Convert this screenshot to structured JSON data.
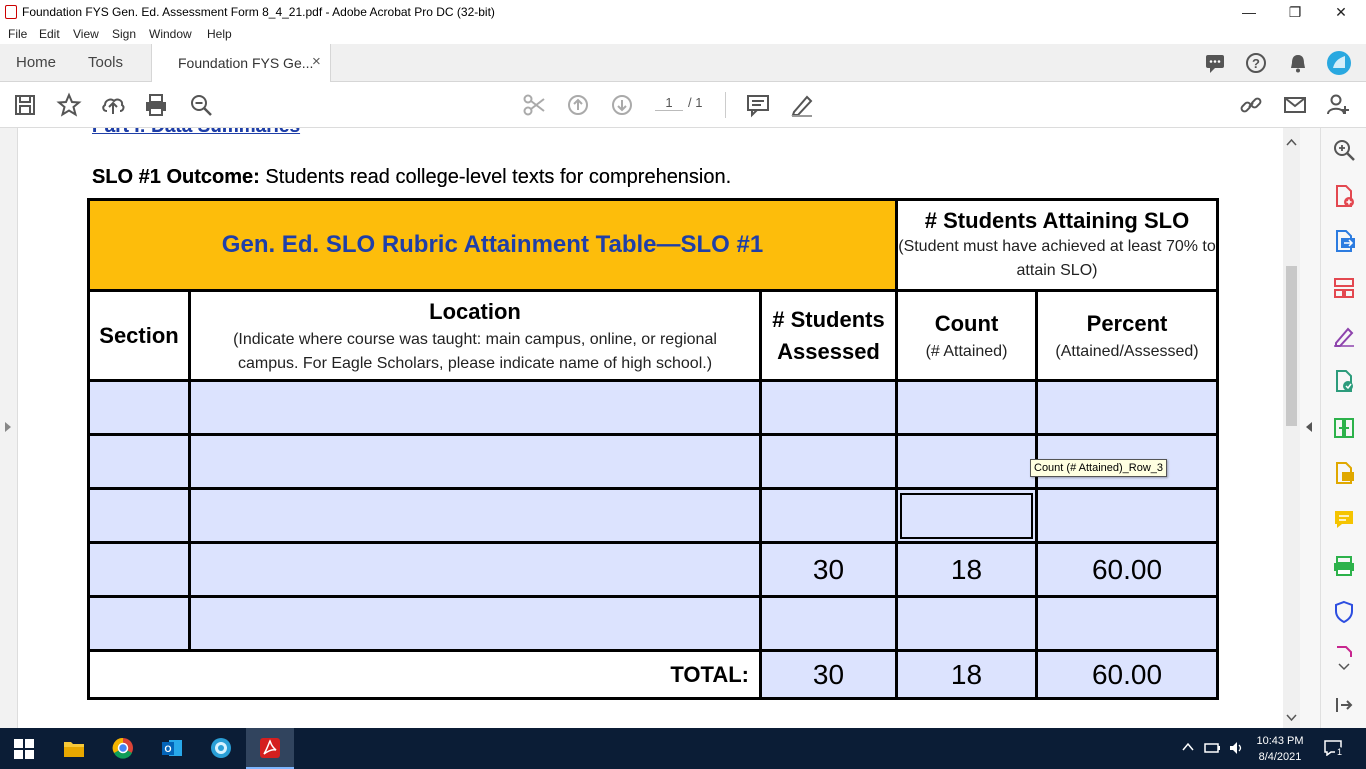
{
  "window": {
    "title": "Foundation FYS Gen. Ed. Assessment Form 8_4_21.pdf - Adobe Acrobat Pro DC (32-bit)",
    "minimize": "—",
    "restore": "❐",
    "close": "✕"
  },
  "menu": [
    "File",
    "Edit",
    "View",
    "Sign",
    "Window",
    "Help"
  ],
  "tabs": {
    "home": "Home",
    "tools": "Tools",
    "document": "Foundation FYS Ge...",
    "close": "×"
  },
  "toolbar": {
    "page_current": "1",
    "page_total": "/ 1"
  },
  "document": {
    "section_heading": "Part I: Data Summaries",
    "slo_label": "SLO #1 Outcome:",
    "slo_text": " Students read college-level texts for comprehension.",
    "table": {
      "title": "Gen. Ed. SLO Rubric Attainment Table—SLO #1",
      "attaining_title": "# Students Attaining SLO",
      "attaining_note": "(Student must have achieved at least 70% to attain SLO)",
      "col_section": "Section",
      "col_location": "Location",
      "col_location_note": "(Indicate where course was taught: main campus, online, or regional campus. For Eagle Scholars, please indicate name of high school.)",
      "col_assessed": "# Students Assessed",
      "col_count": "Count",
      "col_count_note": "(# Attained)",
      "col_percent": "Percent",
      "col_percent_note": "(Attained/Assessed)",
      "rows": [
        {
          "section": "",
          "location": "",
          "assessed": "",
          "count": "",
          "percent": ""
        },
        {
          "section": "",
          "location": "",
          "assessed": "",
          "count": "",
          "percent": ""
        },
        {
          "section": "",
          "location": "",
          "assessed": "",
          "count": "",
          "percent": ""
        },
        {
          "section": "",
          "location": "",
          "assessed": "30",
          "count": "18",
          "percent": "60.00"
        },
        {
          "section": "",
          "location": "",
          "assessed": "",
          "count": "",
          "percent": ""
        }
      ],
      "total_label": "TOTAL:",
      "total_assessed": "30",
      "total_count": "18",
      "total_percent": "60.00"
    },
    "tooltip": "Count (# Attained)_Row_3"
  },
  "taskbar": {
    "time": "10:43 PM",
    "date": "8/4/2021",
    "notification_count": "1"
  }
}
